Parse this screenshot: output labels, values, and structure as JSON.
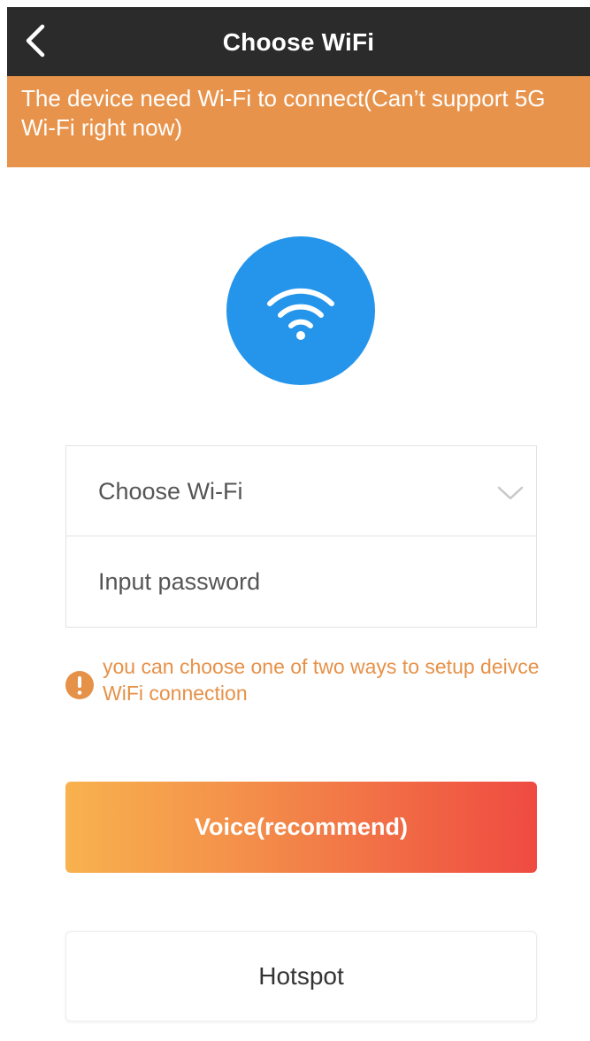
{
  "header": {
    "title": "Choose WiFi",
    "back_icon": "chevron-left-icon",
    "background": "#2b2b2b"
  },
  "notice": {
    "text": "The device need Wi-Fi to connect(Can’t support 5G Wi-Fi right now)",
    "background": "#e8934b"
  },
  "wifi_badge": {
    "icon": "wifi-icon",
    "color": "#2495eb"
  },
  "form": {
    "wifi_select_label": "Choose Wi-Fi",
    "dropdown_icon": "chevron-down-icon",
    "password_placeholder": "Input password"
  },
  "hint": {
    "icon": "warning-icon",
    "text": "you can choose one of two ways to setup deivce WiFi connection",
    "color": "#e69148"
  },
  "buttons": {
    "voice_label": "Voice(recommend)",
    "hotspot_label": "Hotspot",
    "voice_gradient": [
      "#f8b24e",
      "#ef4a41"
    ]
  }
}
